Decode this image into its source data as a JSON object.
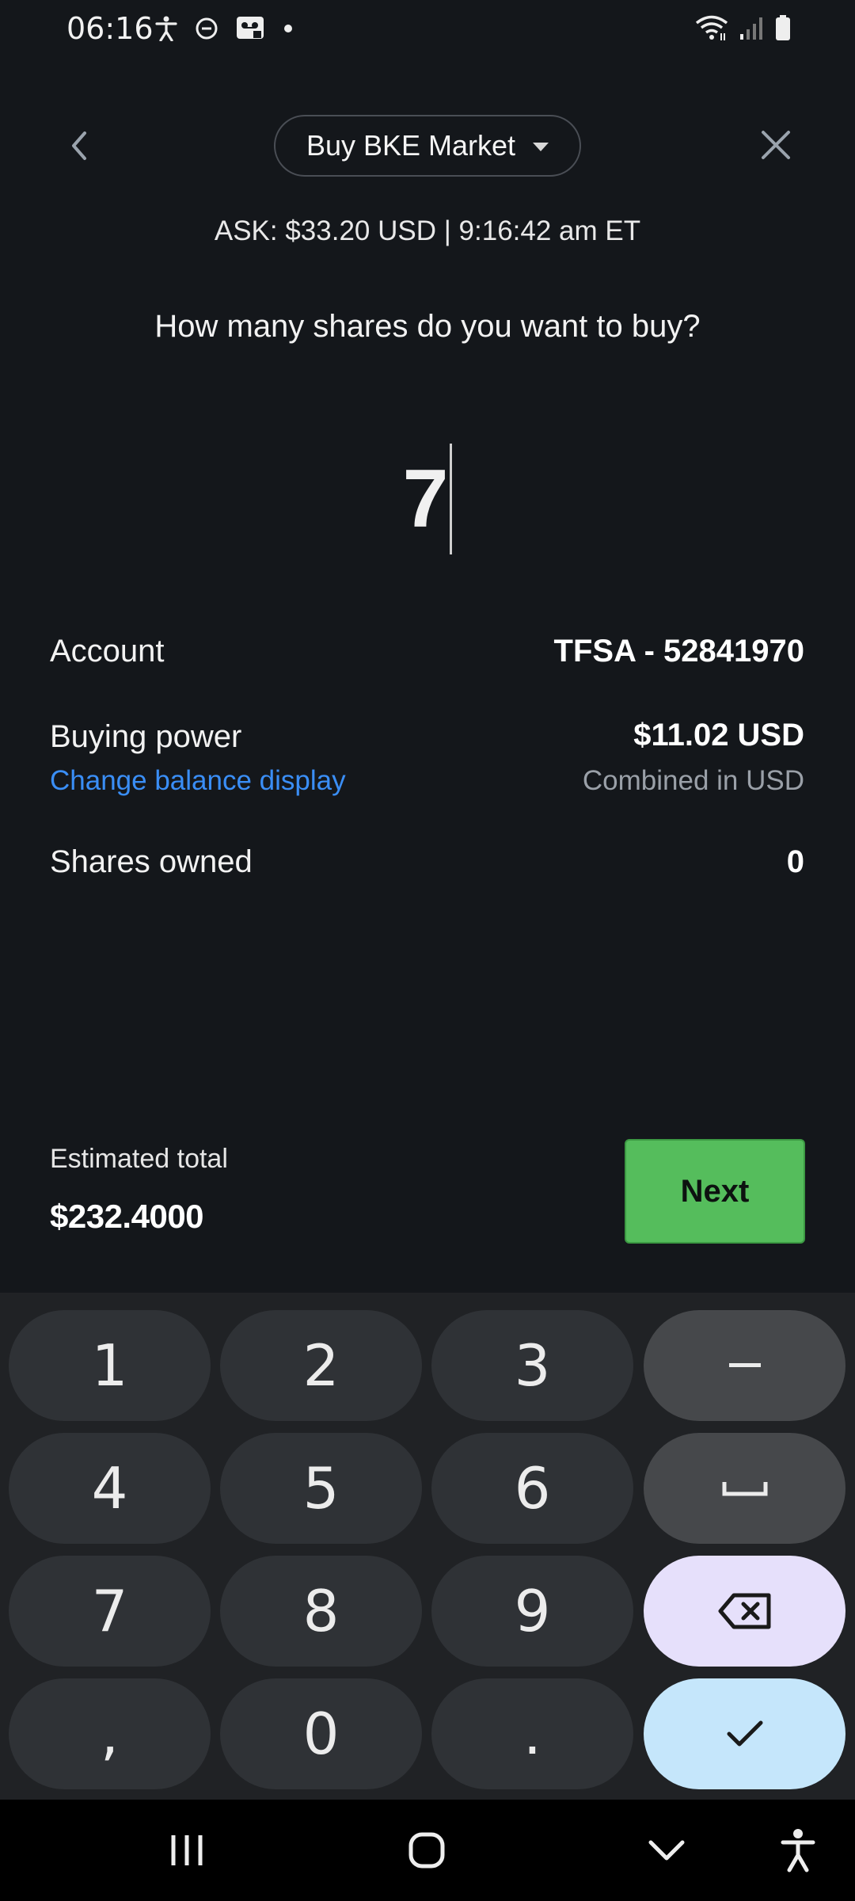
{
  "status_bar": {
    "time": "06:16",
    "left_icons": [
      "accessibility-icon",
      "do-not-disturb-icon",
      "voicemail-icon",
      "notification-dot-icon"
    ],
    "right_icons": [
      "wifi-icon",
      "cell-signal-icon",
      "battery-icon"
    ]
  },
  "header": {
    "order_type": "Buy BKE Market",
    "back_icon": "chevron-left-icon",
    "close_icon": "close-icon"
  },
  "ask_line": "ASK: $33.20 USD | 9:16:42 am ET",
  "question": "How many shares do you want to buy?",
  "quantity": "7",
  "account": {
    "label": "Account",
    "value": "TFSA - 52841970"
  },
  "buying_power": {
    "label": "Buying power",
    "value": "$11.02 USD",
    "link": "Change balance display",
    "sub_value": "Combined in USD"
  },
  "shares_owned": {
    "label": "Shares owned",
    "value": "0"
  },
  "estimated_total": {
    "label": "Estimated total",
    "value": "$232.4000"
  },
  "next_button": "Next",
  "keyboard": {
    "keys": [
      "1",
      "2",
      "3",
      "–",
      "4",
      "5",
      "6",
      "␣",
      "7",
      "8",
      "9",
      "⌫",
      ",",
      "0",
      ".",
      "✓"
    ]
  },
  "nav_bar": [
    "recent-apps-icon",
    "home-icon",
    "hide-keyboard-icon",
    "accessibility-icon"
  ]
}
